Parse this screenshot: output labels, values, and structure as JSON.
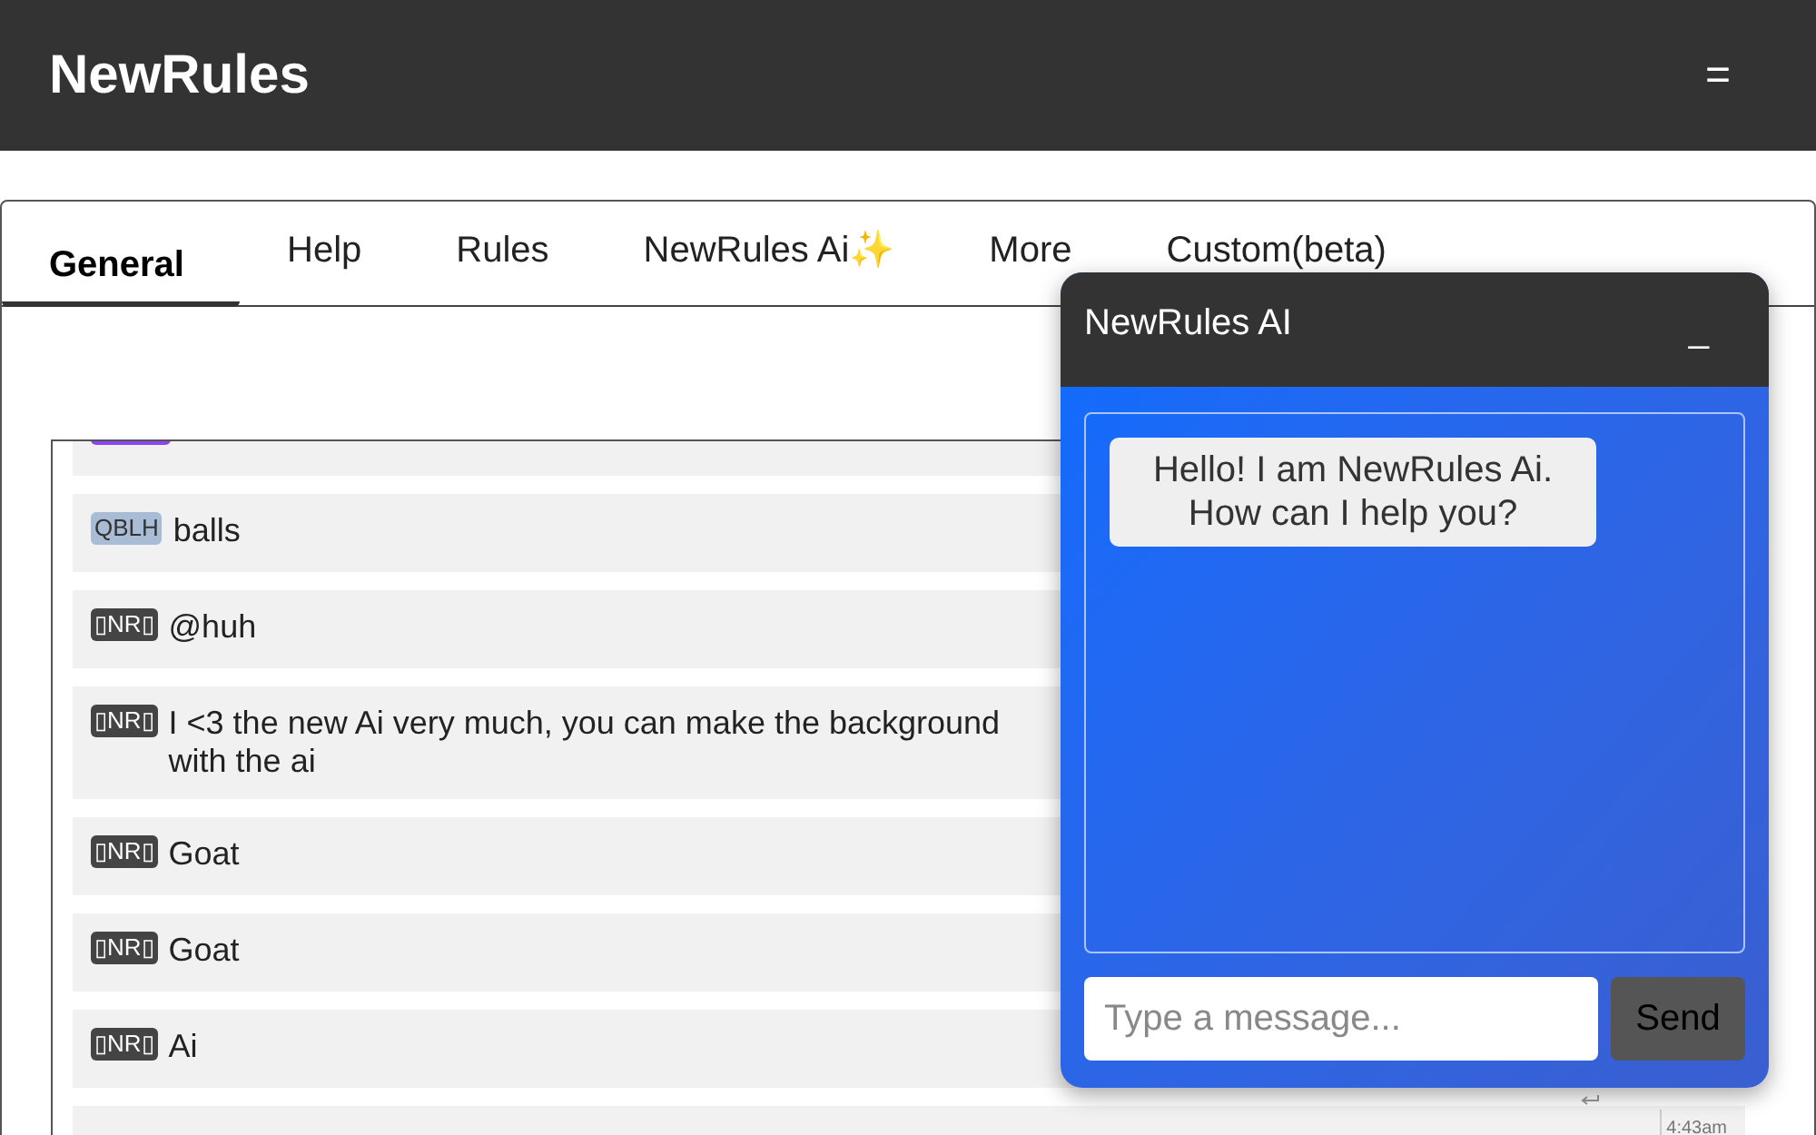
{
  "header": {
    "title": "NewRules",
    "menu_label": "="
  },
  "tabs": [
    {
      "label": "General",
      "selected": true
    },
    {
      "label": "Help",
      "selected": false
    },
    {
      "label": "Rules",
      "selected": false
    },
    {
      "label": "NewRules Ai✨",
      "selected": false
    },
    {
      "label": "More",
      "selected": false
    },
    {
      "label": "Custom(beta)",
      "selected": false
    }
  ],
  "messages": [
    {
      "color": "#8b46f0"
    },
    {
      "badge": "QBLH",
      "color": "#a8bcd6",
      "lines": [
        "balls"
      ]
    },
    {
      "badge": "▯NR▯",
      "color": "#444444",
      "lines": [
        "@huh"
      ]
    },
    {
      "badge": "▯NR▯",
      "color": "#444444",
      "lines": [
        "I <3 the new Ai very much, you can make the background",
        "with the ai"
      ]
    },
    {
      "badge": "▯NR▯",
      "color": "#444444",
      "lines": [
        "Goat"
      ]
    },
    {
      "badge": "▯NR▯",
      "color": "#444444",
      "lines": [
        "Goat"
      ]
    },
    {
      "badge": "▯NR▯",
      "color": "#444444",
      "lines": [
        "Ai"
      ],
      "reply": true
    },
    {
      "time": "4:43am"
    }
  ],
  "ai_chat": {
    "title": "NewRules AI",
    "minimize_label": "_",
    "messages": [
      "Hello! I am NewRules Ai. How can I help you?"
    ],
    "input_placeholder": "Type a message...",
    "send_label": "Send"
  }
}
